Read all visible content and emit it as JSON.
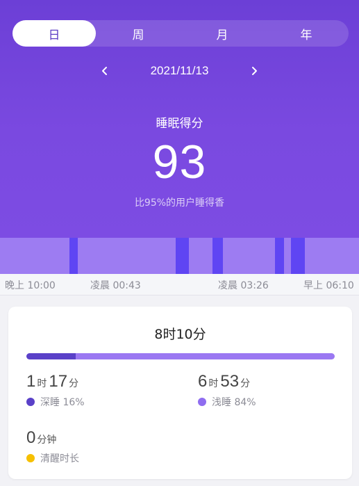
{
  "tabs": [
    {
      "label": "日",
      "active": true
    },
    {
      "label": "周",
      "active": false
    },
    {
      "label": "月",
      "active": false
    },
    {
      "label": "年",
      "active": false
    }
  ],
  "date": "2021/11/13",
  "score": {
    "title": "睡眠得分",
    "value": "93",
    "subtitle": "比95%的用户睡得香"
  },
  "timeline": {
    "deep_sleep_segments_fraction": [
      [
        0.194,
        0.217
      ],
      [
        0.489,
        0.526
      ],
      [
        0.592,
        0.621
      ],
      [
        0.765,
        0.792
      ],
      [
        0.811,
        0.849
      ]
    ],
    "ticks": [
      "晚上 10:00",
      "凌晨 00:43",
      "凌晨 03:26",
      "早上 06:10"
    ],
    "colors": {
      "light": "#9d7cf2",
      "deep": "#5f45f3"
    }
  },
  "summary": {
    "total": "8时10分",
    "deep_fraction": 0.16,
    "deep": {
      "hours": "1",
      "h_unit": "时",
      "minutes": "17",
      "m_unit": "分",
      "label": "深睡 16%",
      "color": "#5a41c8"
    },
    "light": {
      "hours": "6",
      "h_unit": "时",
      "minutes": "53",
      "m_unit": "分",
      "label": "浅睡 84%",
      "color": "#8f6df0"
    },
    "awake": {
      "minutes": "0",
      "m_unit": "分钟",
      "label": "清醒时长",
      "color": "#f6c000"
    }
  }
}
